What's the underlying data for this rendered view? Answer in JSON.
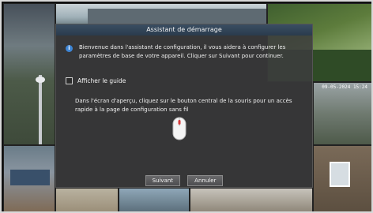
{
  "dialog": {
    "title": "Assistant de démarrage",
    "info_text": "Bienvenue dans l'assistant de configuration, il vous aidera à configurer les paramètres de base de votre appareil. Cliquer sur Suivant pour continuer.",
    "show_guide_label": "Afficher le guide",
    "show_guide_checked": false,
    "hint_text": "Dans l'écran d'aperçu, cliquez sur le bouton central de la souris pour un accès rapide à la page de configuration sans fil",
    "next_label": "Suivant",
    "cancel_label": "Annuler"
  },
  "camera": {
    "osd_timestamp": "09-05-2024 15:24"
  },
  "colors": {
    "info_icon": "#3e86d6",
    "mouse_highlight": "#d63a3a"
  }
}
